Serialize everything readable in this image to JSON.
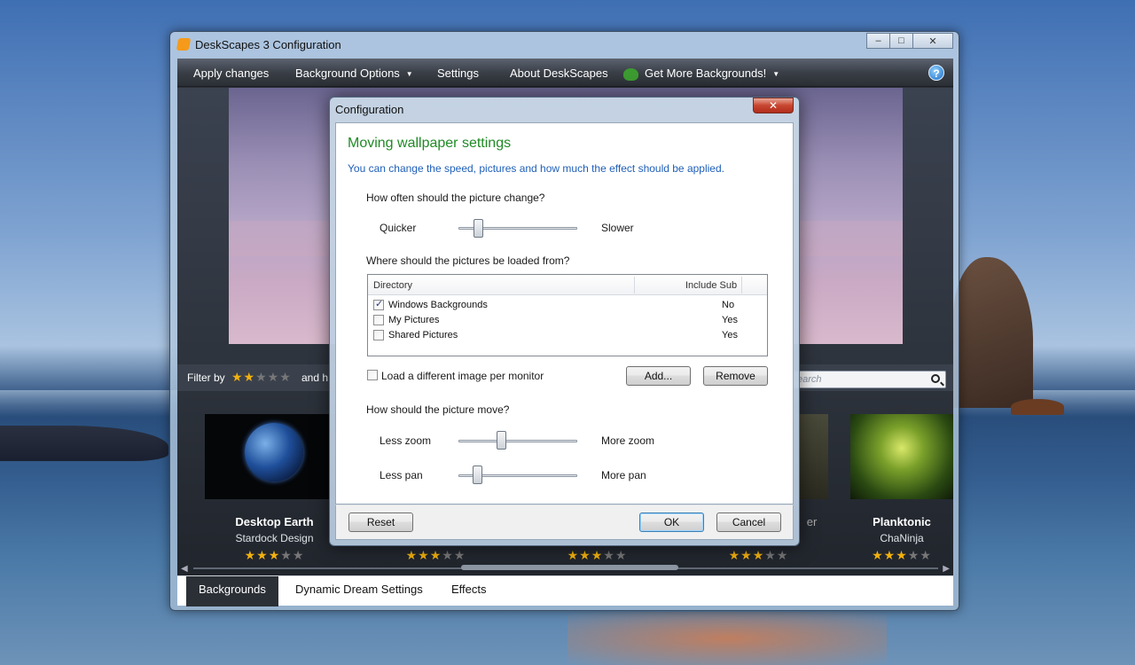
{
  "window": {
    "title": "DeskScapes 3 Configuration",
    "controls": {
      "minimize": "–",
      "maximize": "□",
      "close": "✕"
    }
  },
  "menubar": {
    "apply": "Apply changes",
    "background_options": "Background Options",
    "settings": "Settings",
    "about": "About DeskScapes",
    "get_more": "Get More Backgrounds!",
    "help": "?"
  },
  "filter": {
    "label": "Filter by",
    "stars_on": "★★",
    "stars_off": "★★★",
    "and_text": "and h",
    "search_placeholder": "earch"
  },
  "thumbnails": [
    {
      "name": "Desktop Earth",
      "author": "Stardock Design",
      "stars_on": "★★★",
      "stars_off": "★★"
    },
    {
      "name": "",
      "author": "",
      "stars_on": "★★★",
      "stars_off": "★★"
    },
    {
      "name": "",
      "author": "",
      "stars_on": "★★★",
      "stars_off": "★★"
    },
    {
      "name": "er",
      "author": "",
      "stars_on": "★★★",
      "stars_off": "★★"
    },
    {
      "name": "Planktonic",
      "author": "ChaNinja",
      "stars_on": "★★★",
      "stars_off": "★★"
    }
  ],
  "tabs": [
    "Backgrounds",
    "Dynamic Dream Settings",
    "Effects"
  ],
  "dialog": {
    "title": "Configuration",
    "close": "✕",
    "heading": "Moving wallpaper settings",
    "subtitle": "You can change the speed, pictures and how much the effect should be applied.",
    "q_change": "How often should the picture change?",
    "change_slider": {
      "left": "Quicker",
      "right": "Slower",
      "value_fraction": 0.14
    },
    "q_location": "Where should the pictures be loaded from?",
    "list": {
      "col_directory": "Directory",
      "col_include": "Include Sub",
      "rows": [
        {
          "name": "Windows Backgrounds",
          "include": "No",
          "checked": true
        },
        {
          "name": "My Pictures",
          "include": "Yes",
          "checked": false
        },
        {
          "name": "Shared Pictures",
          "include": "Yes",
          "checked": false
        }
      ]
    },
    "per_monitor": "Load a different image per monitor",
    "add": "Add...",
    "remove": "Remove",
    "q_move": "How should the picture move?",
    "zoom_slider": {
      "left": "Less zoom",
      "right": "More zoom",
      "value_fraction": 0.35
    },
    "pan_slider": {
      "left": "Less pan",
      "right": "More pan",
      "value_fraction": 0.13
    },
    "reset": "Reset",
    "ok": "OK",
    "cancel": "Cancel"
  }
}
